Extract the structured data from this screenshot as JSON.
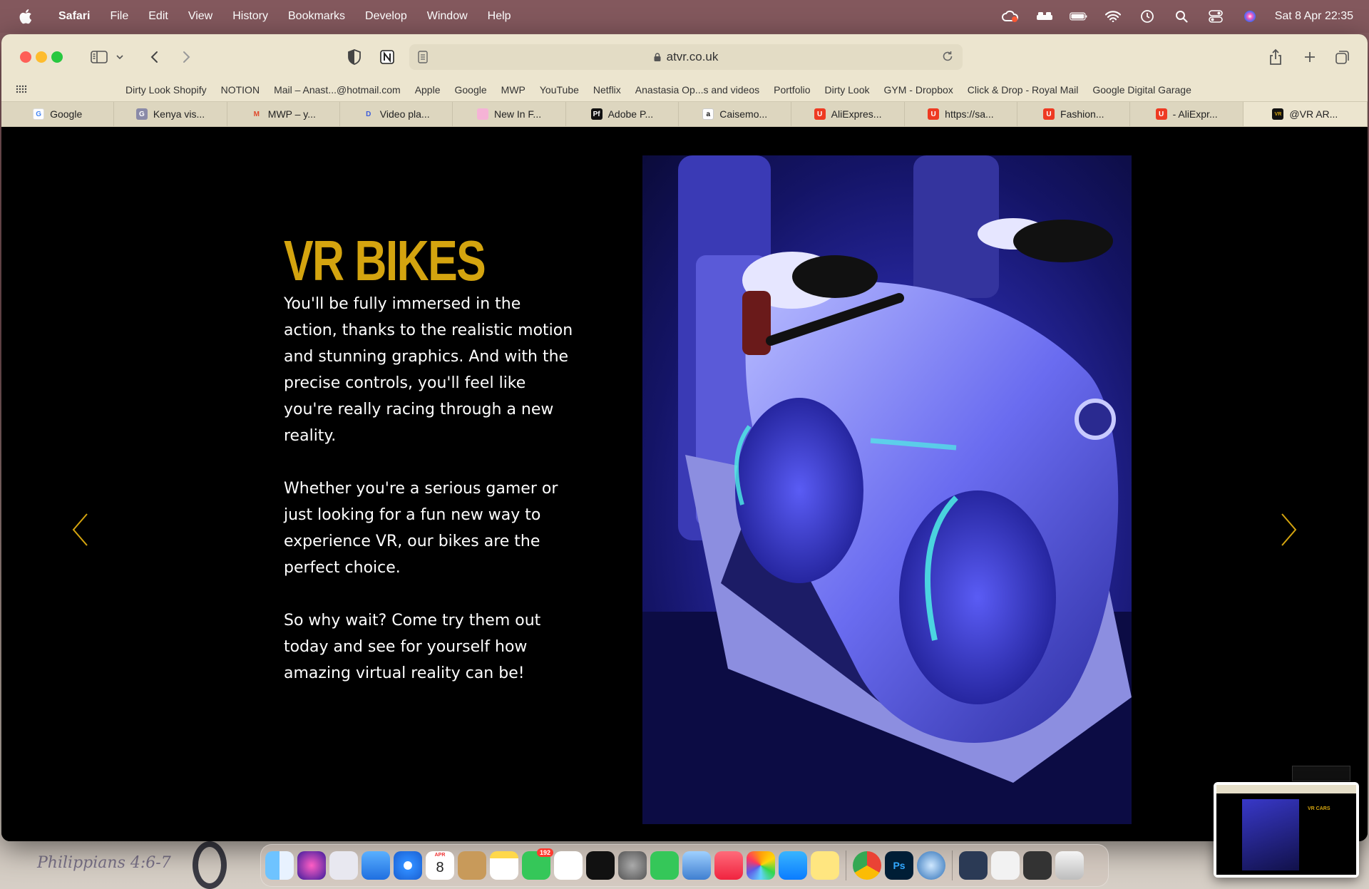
{
  "menubar": {
    "app": "Safari",
    "items": [
      "File",
      "Edit",
      "View",
      "History",
      "Bookmarks",
      "Develop",
      "Window",
      "Help"
    ],
    "clock": "Sat 8 Apr  22:35"
  },
  "toolbar": {
    "url": "atvr.co.uk"
  },
  "bookmarks": [
    "Dirty Look Shopify",
    "NOTION",
    "Mail – Anast...@hotmail.com",
    "Apple",
    "Google",
    "MWP",
    "YouTube",
    "Netflix",
    "Anastasia Op...s and videos",
    "Portfolio",
    "Dirty Look",
    "GYM - Dropbox",
    "Click & Drop - Royal Mail",
    "Google Digital Garage"
  ],
  "tabs": [
    {
      "label": "Google",
      "color": "#ffffff",
      "glyph": "G"
    },
    {
      "label": "Kenya vis...",
      "color": "#8a8aa8",
      "glyph": "G"
    },
    {
      "label": "MWP – y...",
      "color": "#e0482c",
      "glyph": "M"
    },
    {
      "label": "Video pla...",
      "color": "#3b5bdb",
      "glyph": "D"
    },
    {
      "label": "New In F...",
      "color": "#f5b3d6",
      "glyph": ""
    },
    {
      "label": "Adobe P...",
      "color": "#111111",
      "glyph": "Pf"
    },
    {
      "label": "Caisemo...",
      "color": "#ffffff",
      "glyph": "a"
    },
    {
      "label": "AliExpres...",
      "color": "#ee3a22",
      "glyph": "U"
    },
    {
      "label": "https://sa...",
      "color": "#ee3a22",
      "glyph": "U"
    },
    {
      "label": "Fashion...",
      "color": "#ee3a22",
      "glyph": "U"
    },
    {
      "label": "- AliExpr...",
      "color": "#ee3a22",
      "glyph": "U"
    },
    {
      "label": "@VR AR...",
      "color": "#111111",
      "glyph": "VR"
    }
  ],
  "page": {
    "heading": "VR BIKES",
    "paragraphs": [
      "You'll be fully immersed in the action, thanks to the realistic motion and stunning graphics. And with the precise controls, you'll feel like you're really racing through a new reality.",
      "Whether you're a serious gamer or just looking for a fun new way to experience VR, our bikes are the perfect choice.",
      "So why wait? Come try them out today and see for yourself how amazing virtual reality can be!"
    ],
    "accent_color": "#d4a40f"
  },
  "thumbnail": {
    "title": "VR CARS"
  },
  "desktop": {
    "note": "Philippians 4:6-7"
  },
  "dock": {
    "calendar_month": "APR",
    "calendar_day": "8",
    "messages_badge": "192",
    "apps": [
      "Finder",
      "Siri",
      "Launchpad",
      "Mail",
      "Safari",
      "Calendar",
      "Contacts",
      "Notes",
      "Messages",
      "Reminders",
      "Tidal",
      "System Settings",
      "FaceTime",
      "Preview",
      "Music",
      "Photos",
      "App Store",
      "Stickies",
      "Chrome",
      "Photoshop",
      "QuickTime",
      "Downloads",
      "Documents",
      "Screenshots",
      "Trash"
    ]
  }
}
